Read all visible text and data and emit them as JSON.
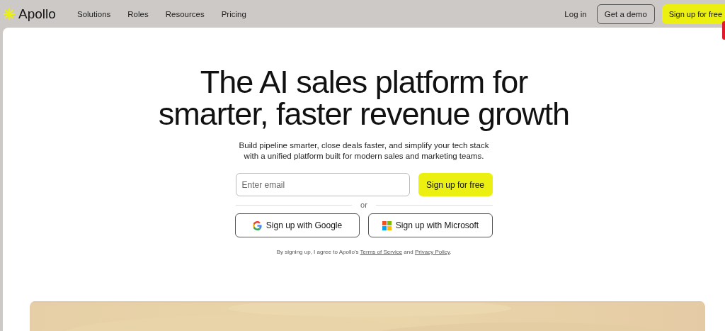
{
  "nav": {
    "brand": "Apollo",
    "links": [
      "Solutions",
      "Roles",
      "Resources",
      "Pricing"
    ],
    "login": "Log in",
    "demo": "Get a demo",
    "signup": "Sign up for free"
  },
  "hero": {
    "title_lines": [
      "The AI sales platform for",
      "smarter, faster revenue growth"
    ],
    "subtitle_lines": [
      "Build pipeline smarter, close deals faster, and simplify your tech stack",
      "with a unified platform built for modern sales and marketing teams."
    ],
    "email": {
      "placeholder": "Enter email"
    },
    "submit": "Sign up for free",
    "divider": "or",
    "providers": [
      {
        "kind": "google",
        "label": "Sign up with Google"
      },
      {
        "kind": "microsoft",
        "label": "Sign up with Microsoft"
      }
    ],
    "legal": {
      "before": "By signing up, I agree to Apollo's",
      "terms": "Terms of Service",
      "middle": "and",
      "privacy": "Privacy Policy",
      "after": "."
    }
  }
}
